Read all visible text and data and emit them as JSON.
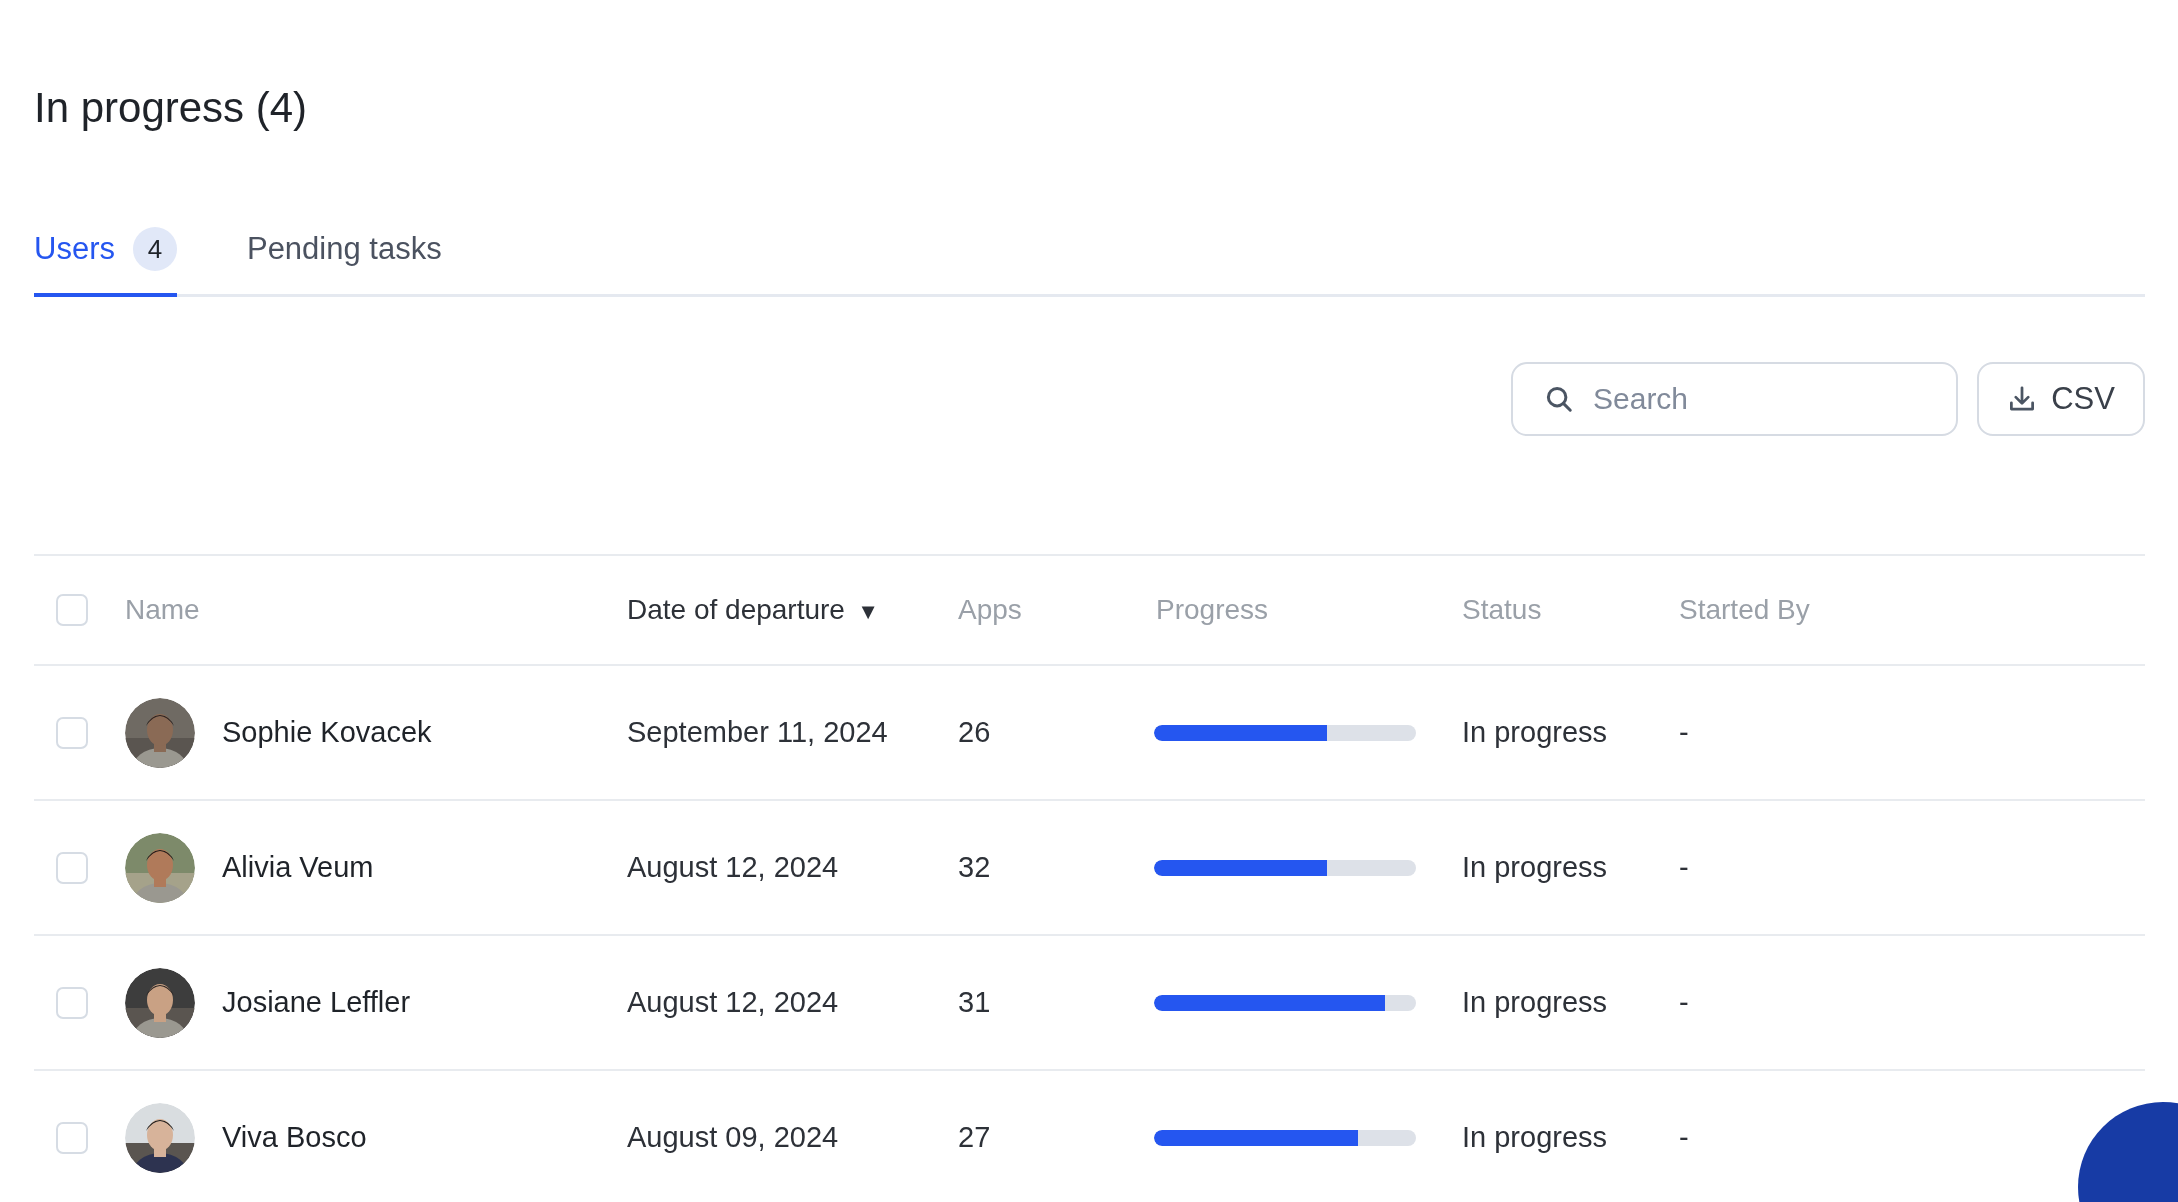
{
  "title": "In progress (4)",
  "tabs": [
    {
      "label": "Users",
      "badge": "4",
      "selected": true
    },
    {
      "label": "Pending tasks",
      "selected": false
    }
  ],
  "search": {
    "placeholder": "Search"
  },
  "export_button": "CSV",
  "table": {
    "select_all": {
      "checked": false
    },
    "columns": [
      {
        "label": "Name",
        "sorted": false
      },
      {
        "label": "Date of departure",
        "sorted": true,
        "sort_icon": "▼"
      },
      {
        "label": "Apps",
        "sorted": false
      },
      {
        "label": "Progress",
        "sorted": false
      },
      {
        "label": "Status",
        "sorted": false
      },
      {
        "label": "Started By",
        "sorted": false
      }
    ],
    "rows": [
      {
        "checked": false,
        "name": "Sophie Kovacek",
        "date": "September 11, 2024",
        "apps": "26",
        "level": 0.66,
        "status": "In progress",
        "started_by": "-"
      },
      {
        "checked": false,
        "name": "Alivia Veum",
        "date": "August 12, 2024",
        "apps": "32",
        "level": 0.66,
        "status": "In progress",
        "started_by": "-"
      },
      {
        "checked": false,
        "name": "Josiane Leffler",
        "date": "August 12, 2024",
        "apps": "31",
        "level": 0.88,
        "status": "In progress",
        "started_by": "-"
      },
      {
        "checked": false,
        "name": "Viva Bosco",
        "date": "August 09, 2024",
        "apps": "27",
        "level": 0.78,
        "status": "In progress",
        "started_by": "-"
      }
    ]
  }
}
